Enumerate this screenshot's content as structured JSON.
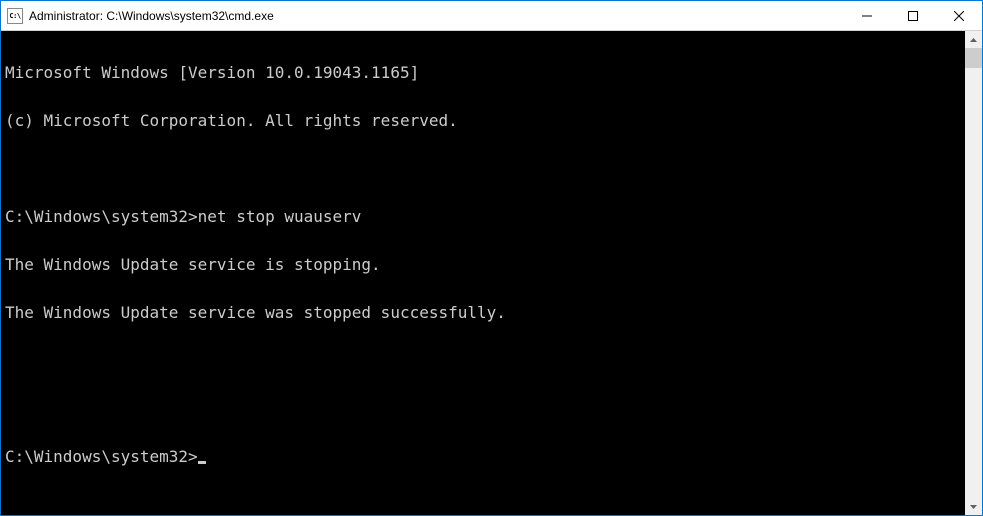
{
  "window": {
    "title": "Administrator: C:\\Windows\\system32\\cmd.exe"
  },
  "console": {
    "lines": [
      "Microsoft Windows [Version 10.0.19043.1165]",
      "(c) Microsoft Corporation. All rights reserved.",
      "",
      "C:\\Windows\\system32>net stop wuauserv",
      "The Windows Update service is stopping.",
      "The Windows Update service was stopped successfully.",
      "",
      ""
    ],
    "prompt": "C:\\Windows\\system32>"
  }
}
